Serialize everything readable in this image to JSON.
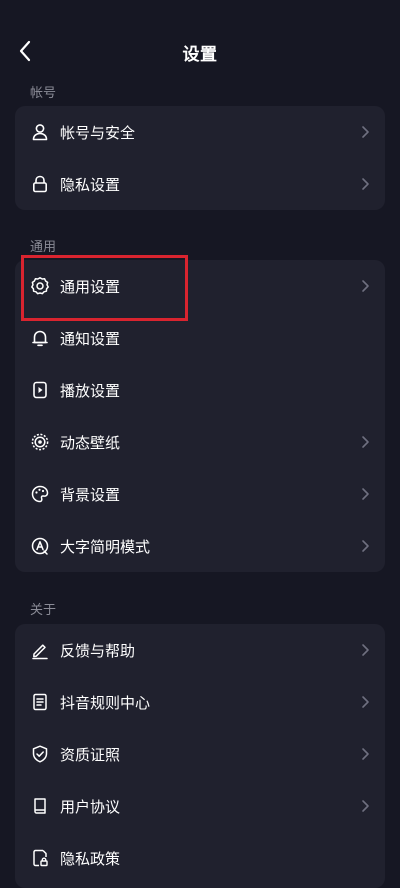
{
  "header": {
    "title": "设置",
    "back_icon": "back-arrow-icon"
  },
  "sections": [
    {
      "label": "帐号",
      "items": [
        {
          "label": "帐号与安全",
          "icon": "user-icon",
          "chevron": true
        },
        {
          "label": "隐私设置",
          "icon": "lock-icon",
          "chevron": true
        }
      ]
    },
    {
      "label": "通用",
      "items": [
        {
          "label": "通用设置",
          "icon": "gear-icon",
          "chevron": true
        },
        {
          "label": "通知设置",
          "icon": "bell-icon",
          "chevron": false
        },
        {
          "label": "播放设置",
          "icon": "play-settings-icon",
          "chevron": false
        },
        {
          "label": "动态壁纸",
          "icon": "wallpaper-icon",
          "chevron": true
        },
        {
          "label": "背景设置",
          "icon": "palette-icon",
          "chevron": true
        },
        {
          "label": "大字简明模式",
          "icon": "font-mode-icon",
          "chevron": true
        }
      ]
    },
    {
      "label": "关于",
      "items": [
        {
          "label": "反馈与帮助",
          "icon": "pen-icon",
          "chevron": true
        },
        {
          "label": "抖音规则中心",
          "icon": "document-icon",
          "chevron": true
        },
        {
          "label": "资质证照",
          "icon": "shield-check-icon",
          "chevron": true
        },
        {
          "label": "用户协议",
          "icon": "book-icon",
          "chevron": true
        },
        {
          "label": "隐私政策",
          "icon": "privacy-doc-icon",
          "chevron": false
        }
      ]
    }
  ],
  "highlight": {
    "target": "通用设置",
    "color": "#d9242f"
  },
  "colors": {
    "background": "#161723",
    "card": "#20212e",
    "section_label": "#8a8b96",
    "chevron": "#6f7080"
  }
}
